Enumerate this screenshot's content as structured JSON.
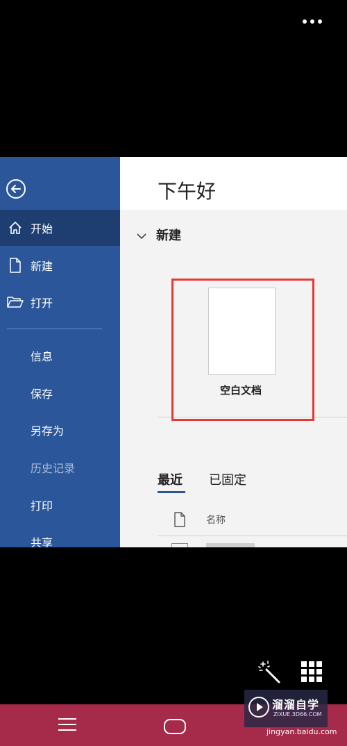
{
  "top": {
    "more_icon": "more-dots-icon"
  },
  "sidebar": {
    "back_icon": "back-arrow-icon",
    "items": [
      {
        "label": "开始",
        "icon": "home-icon",
        "active": true
      },
      {
        "label": "新建",
        "icon": "new-document-icon"
      },
      {
        "label": "打开",
        "icon": "folder-open-icon"
      }
    ],
    "sub_items": [
      {
        "label": "信息"
      },
      {
        "label": "保存"
      },
      {
        "label": "另存为"
      },
      {
        "label": "历史记录",
        "disabled": true
      },
      {
        "label": "打印"
      },
      {
        "label": "共享"
      }
    ]
  },
  "main": {
    "greeting": "下午好",
    "new_section": {
      "title": "新建",
      "templates": [
        {
          "label": "空白文档"
        }
      ]
    },
    "tabs": [
      {
        "label": "最近",
        "active": true
      },
      {
        "label": "已固定"
      }
    ],
    "list_header": {
      "name_label": "名称"
    }
  },
  "overlay": {
    "magic_icon": "magic-wand-icon",
    "grid_icon": "grid-icon"
  },
  "navbar": {
    "menu_icon": "menu-icon",
    "home_icon": "home-pill-icon"
  },
  "watermark": {
    "title": "溜溜自学",
    "sub": "ZIXUE.3D66.COM",
    "site": "jingyan.baidu.com"
  },
  "colors": {
    "sidebar": "#2b579a",
    "sidebar_active": "#1e3e72",
    "highlight_box": "#e53935",
    "navbar": "#a62a4a"
  }
}
